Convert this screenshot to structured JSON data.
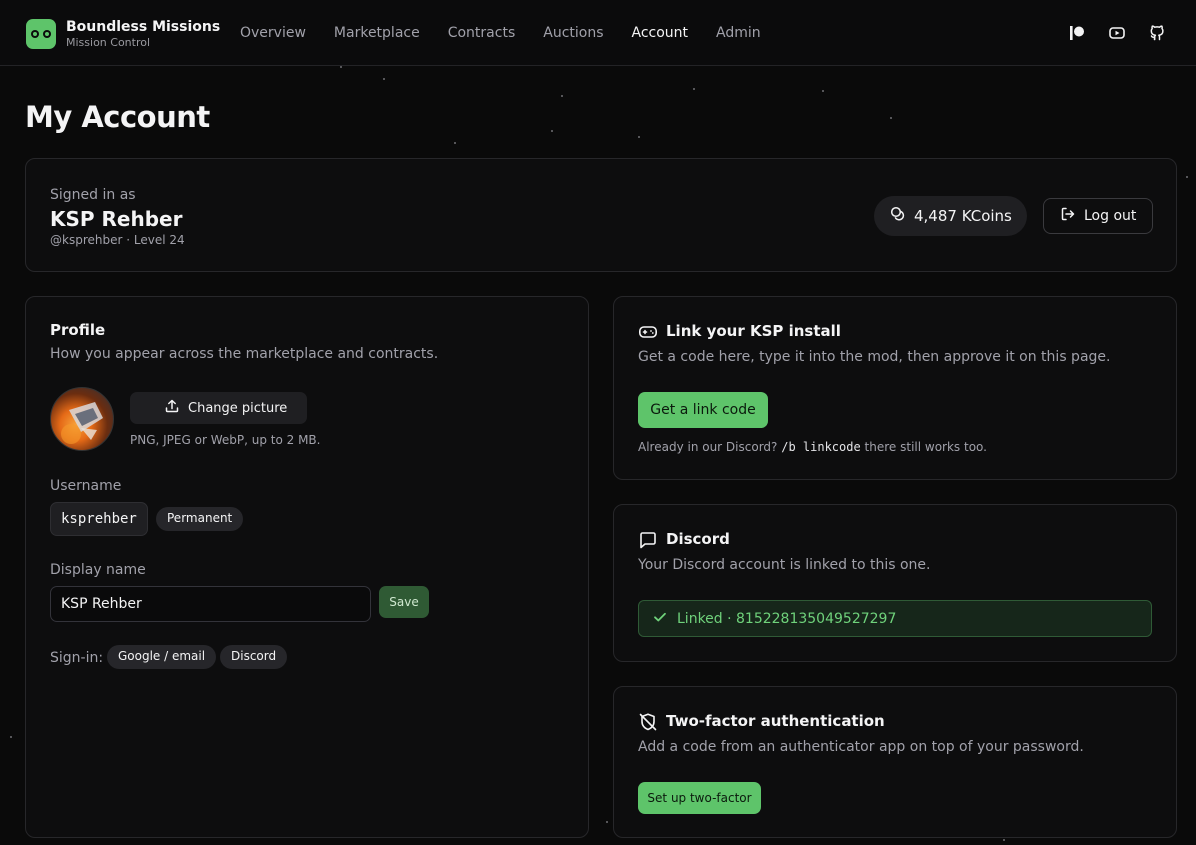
{
  "brand": {
    "title": "Boundless Missions",
    "subtitle": "Mission Control"
  },
  "nav": {
    "items": [
      {
        "label": "Overview"
      },
      {
        "label": "Marketplace"
      },
      {
        "label": "Contracts"
      },
      {
        "label": "Auctions"
      },
      {
        "label": "Account",
        "active": true
      },
      {
        "label": "Admin"
      }
    ]
  },
  "header_icons": [
    "patreon-icon",
    "youtube-icon",
    "github-icon"
  ],
  "page_title": "My Account",
  "account": {
    "signed_in_label": "Signed in as",
    "display_name": "KSP Rehber",
    "handle_level": "@ksprehber · Level 24",
    "coins": "4,487 KCoins",
    "logout_label": "Log out"
  },
  "profile": {
    "title": "Profile",
    "subtitle": "How you appear across the marketplace and contracts.",
    "change_picture_label": "Change picture",
    "picture_hint": "PNG, JPEG or WebP, up to 2 MB.",
    "username_label": "Username",
    "username_value": "ksprehber",
    "username_badge": "Permanent",
    "display_name_label": "Display name",
    "display_name_value": "KSP Rehber",
    "save_label": "Save",
    "signin_label": "Sign-in:",
    "signin_methods": [
      "Google / email",
      "Discord"
    ]
  },
  "link_install": {
    "title": "Link your KSP install",
    "subtitle": "Get a code here, type it into the mod, then approve it on this page.",
    "button_label": "Get a link code",
    "hint_prefix": "Already in our Discord?",
    "hint_code": "/b linkcode",
    "hint_suffix": "there still works too."
  },
  "discord": {
    "title": "Discord",
    "subtitle": "Your Discord account is linked to this one.",
    "status": "Linked · 815228135049527297"
  },
  "two_factor": {
    "title": "Two-factor authentication",
    "subtitle": "Add a code from an authenticator app on top of your password.",
    "button_label": "Set up two-factor"
  },
  "colors": {
    "accent": "#5ec46a",
    "background": "#0a0a0a",
    "card": "#0d0d0e",
    "border": "#27272a",
    "muted_text": "#a1a1aa"
  }
}
